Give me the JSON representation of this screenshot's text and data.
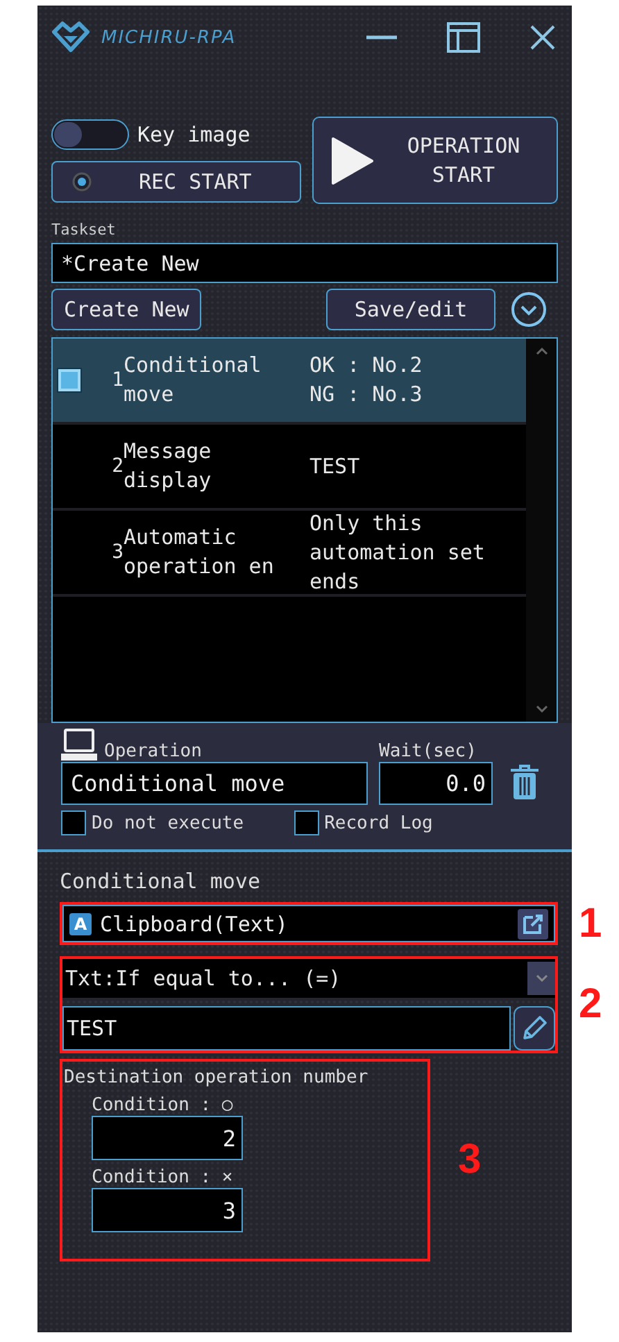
{
  "app": {
    "title": "MICHIRU-RPA"
  },
  "key_image": {
    "label": "Key image",
    "on": false
  },
  "rec_button": {
    "label": "REC START"
  },
  "start_button": {
    "label": "OPERATION START"
  },
  "taskset": {
    "label": "Taskset",
    "value": "*Create New"
  },
  "buttons": [
    "Create New",
    "Save/edit"
  ],
  "operations": [
    {
      "number": "1",
      "name": "Conditional move",
      "detail_lines": [
        "OK : No.2",
        "NG : No.3"
      ],
      "selected": true
    },
    {
      "number": "2",
      "name": "Message display",
      "detail_lines": [
        "TEST"
      ],
      "selected": false
    },
    {
      "number": "3",
      "name": "Automatic operation en",
      "detail_lines": [
        "Only this",
        "automation set",
        "ends"
      ],
      "selected": false
    }
  ],
  "operation": {
    "label": "Operation",
    "value": "Conditional move"
  },
  "wait": {
    "label": "Wait(sec)",
    "value": "0.0"
  },
  "options": [
    {
      "label": "Do not execute",
      "checked": false
    },
    {
      "label": "Record Log",
      "checked": false
    }
  ],
  "editor": {
    "title": "Conditional move",
    "source": {
      "type_badge": "A",
      "value": "Clipboard(Text)",
      "annotation": "1"
    },
    "condition": {
      "comparison": "Txt:If equal to... (=)",
      "text": "TEST",
      "annotation": "2"
    },
    "destination": {
      "label": "Destination operation number",
      "annotation": "3",
      "conditions": [
        {
          "label": "Condition : ○",
          "value": "2"
        },
        {
          "label": "Condition : ×",
          "value": "3"
        }
      ]
    }
  }
}
